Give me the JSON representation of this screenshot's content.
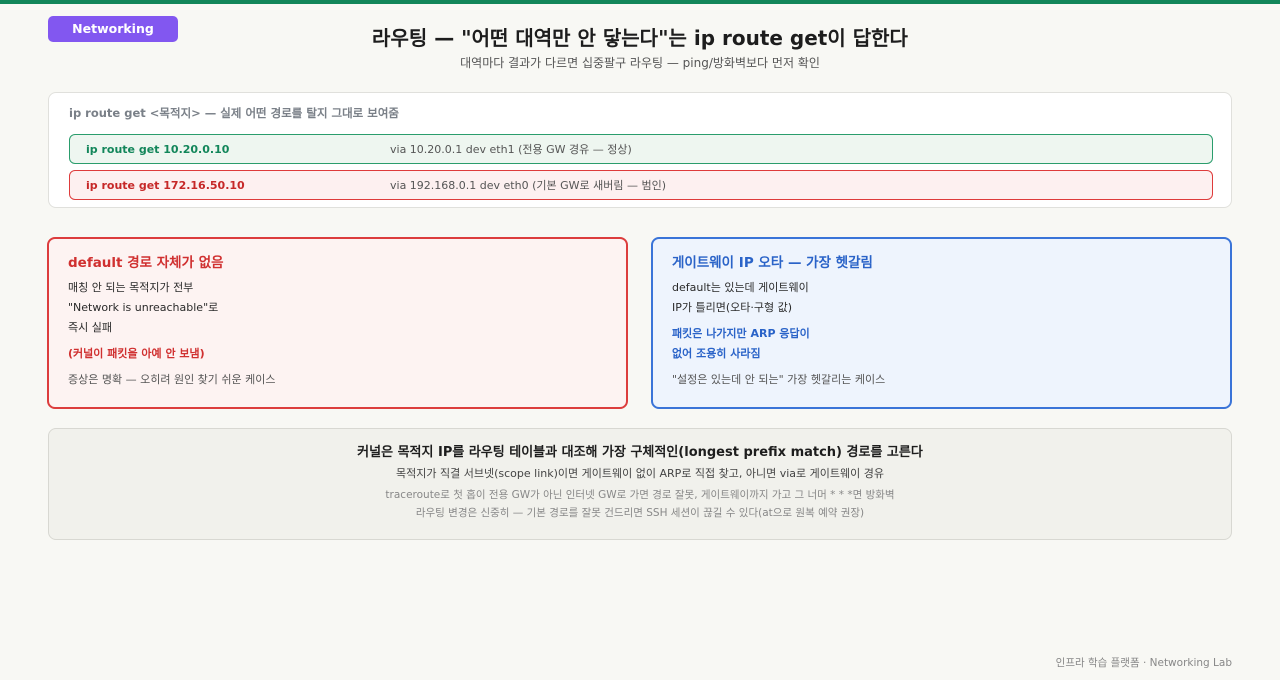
{
  "badge": "Networking",
  "title": "라우팅 — \"어떤 대역만 안 닿는다\"는 ip route get이 답한다",
  "subtitle": "대역마다 결과가 다르면 십중팔구 라우팅 — ping/방화벽보다 먼저 확인",
  "route_panel": {
    "title": "ip route get <목적지> — 실제 어떤 경로를 탈지 그대로 보여줌",
    "rows": [
      {
        "command": "ip route get 10.20.0.10",
        "result": "via 10.20.0.1 dev eth1 (전용 GW 경유 — 정상)"
      },
      {
        "command": "ip route get 172.16.50.10",
        "result": "via 192.168.0.1 dev eth0 (기본 GW로 새버림 — 범인)"
      }
    ]
  },
  "card_default": {
    "title": "default 경로 자체가 없음",
    "line1": "매칭 안 되는 목적지가 전부",
    "line2": "\"Network is unreachable\"로",
    "line3": "즉시 실패",
    "emphasis": "(커널이 패킷을 아예 안 보냄)",
    "note": "증상은 명확 — 오히려 원인 찾기 쉬운 케이스"
  },
  "card_gateway": {
    "title": "게이트웨이 IP 오타 — 가장 헷갈림",
    "line1": "default는 있는데 게이트웨이",
    "line2": "IP가 틀리면(오타·구형 값)",
    "emphasis1": "패킷은 나가지만 ARP 응답이",
    "emphasis2": "없어 조용히 사라짐",
    "note": "\"설정은 있는데 안 되는\" 가장 헷갈리는 케이스"
  },
  "bottom": {
    "title": "커널은 목적지 IP를 라우팅 테이블과 대조해 가장 구체적인(longest prefix match) 경로를 고른다",
    "line1": "목적지가 직결 서브넷(scope link)이면 게이트웨이 없이 ARP로 직접 찾고, 아니면 via로 게이트웨이 경유",
    "line2": "traceroute로 첫 홉이 전용 GW가 아닌 인터넷 GW로 가면 경로 잘못, 게이트웨이까지 가고 그 너머 * * *면 방화벽",
    "line3": "라우팅 변경은 신중히 — 기본 경로를 잘못 건드리면 SSH 세션이 끊길 수 있다(at으로 원복 예약 권장)"
  },
  "footer": "인프라 학습 플랫폼 · Networking Lab",
  "colors": {
    "accent_green": "#12865a",
    "accent_purple": "#8257f0",
    "alert_red": "#dc3d3d",
    "info_blue": "#3a74d8"
  }
}
